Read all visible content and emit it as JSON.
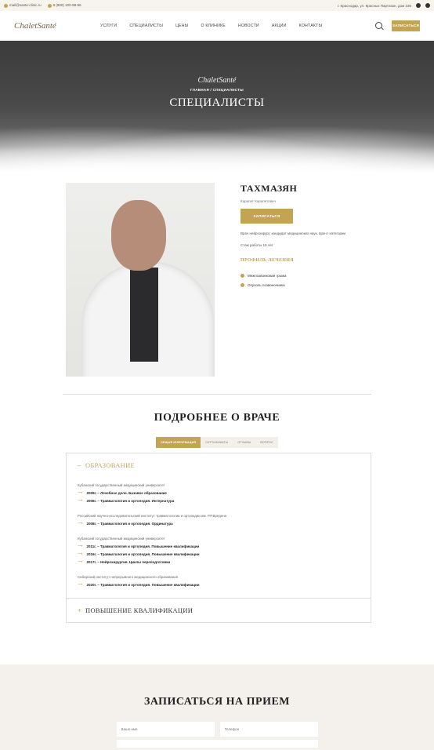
{
  "topbar": {
    "email": "mail@sante-clinic.ru",
    "phone": "8 (800) 100-98-96",
    "address": "г. Краснодар, ул. Красных Партизан, дом 236"
  },
  "header": {
    "logo": "ChaletSanté",
    "nav": [
      "УСЛУГИ",
      "СПЕЦИАЛИСТЫ",
      "ЦЕНЫ",
      "О КЛИНИКЕ",
      "НОВОСТИ",
      "АКЦИИ",
      "КОНТАКТЫ"
    ],
    "cta": "ЗАПИСАТЬСЯ"
  },
  "hero": {
    "logo": "ChaletSanté",
    "breadcrumb": "ГЛАВНАЯ  /  СПЕЦИАЛИСТЫ",
    "title": "СПЕЦИАЛИСТЫ"
  },
  "doctor": {
    "surname": "ТАХМАЗЯН",
    "name": "Карапет Карапетович",
    "signup": "ЗАПИСАТЬСЯ",
    "description": "Врач нейрохирург, кандидат медицинских наук, врач I категории",
    "experience": "Стаж работы 19 лет",
    "profile_title": "ПРОФИЛЬ ЛЕЧЕНИЯ",
    "profile": [
      "Межпозвонковая грыжа",
      "Опухоль позвоночника"
    ]
  },
  "more": {
    "title": "ПОДРОБНЕЕ О ВРАЧЕ",
    "tabs": [
      "ОБЩАЯ ИНФОРМАЦИЯ",
      "СЕРТИФИКАТЫ",
      "ОТЗЫВЫ",
      "ВОПРОС"
    ]
  },
  "education": {
    "title": "ОБРАЗОВАНИЕ",
    "blocks": [
      {
        "inst": "Кубанский государственный медицинский университет",
        "rows": [
          "2005г. – Лечебное дело. Базовое образование",
          "2006г. – Травматология и ортопедия. Интернатура"
        ]
      },
      {
        "inst": "Российский научно-исследовательский институт травматологии и ортопедии им. Р.Р.Вредена",
        "rows": [
          "2008г. – Травматология и ортопедия. Ординатура"
        ]
      },
      {
        "inst": "Кубанский государственный медицинский университет",
        "rows": [
          "2011г. – Травматология и ортопедия. Повышение квалификации",
          "2016г. – Травматология и ортопедия. Повышение квалификации",
          "2017г. – Нейрохирургия. Циклы переподготовки"
        ]
      },
      {
        "inst": "Сибирский институт непрерывного медицинского образования",
        "rows": [
          "2020г. – Травматология и ортопедия. Повышение квалификации"
        ]
      }
    ]
  },
  "qualification": {
    "title": "ПОВЫШЕНИЕ КВАЛИФИКАЦИИ"
  },
  "form": {
    "title": "ЗАПИСАТЬСЯ НА ПРИЕМ",
    "name_placeholder": "Ваше имя",
    "phone_placeholder": "Телефон"
  }
}
